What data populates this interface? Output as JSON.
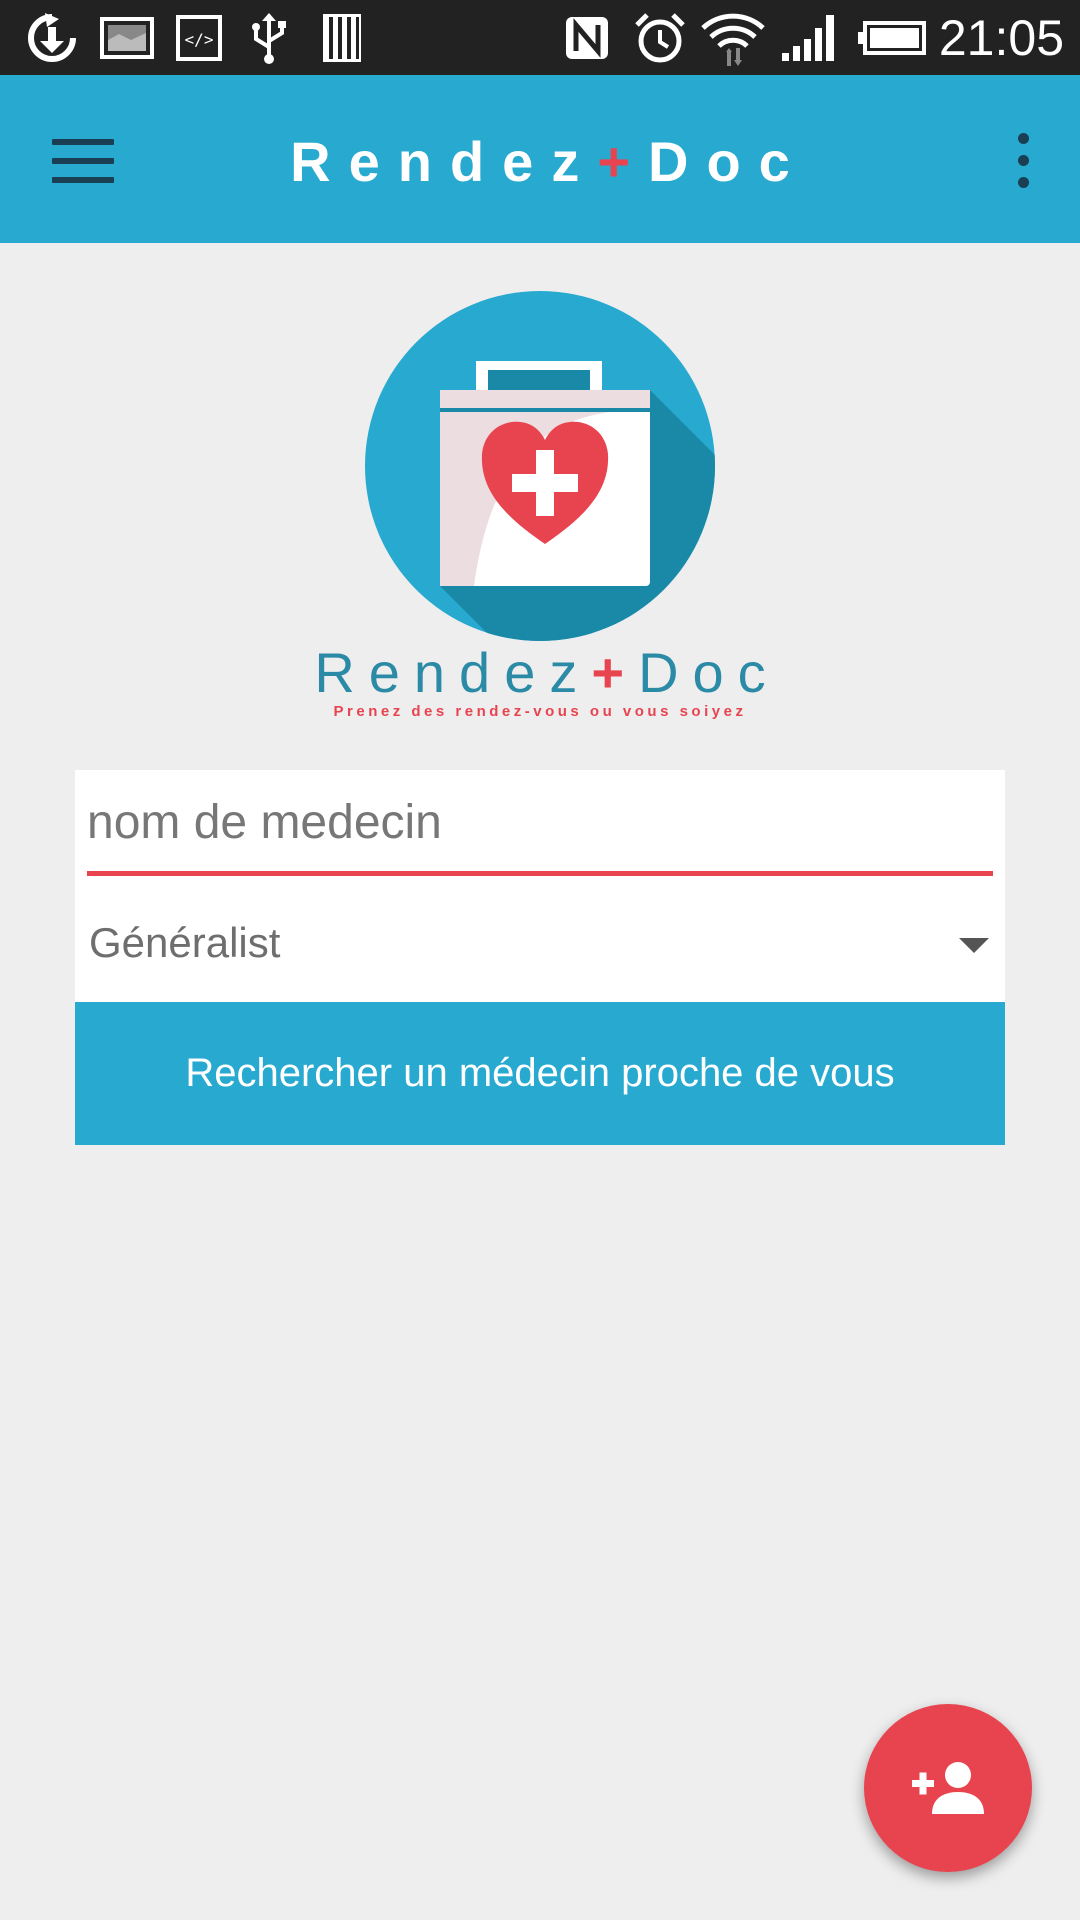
{
  "status_bar": {
    "time": "21:05",
    "icons": [
      "sync-download-icon",
      "image-icon",
      "code-icon",
      "usb-icon",
      "sd-card-icon",
      "nfc-icon",
      "alarm-icon",
      "wifi-icon",
      "signal-icon",
      "battery-icon"
    ]
  },
  "app_bar": {
    "title_left": "Rendez",
    "title_plus": "+",
    "title_right": "Doc",
    "menu_icon": "hamburger-menu-icon",
    "overflow_icon": "more-vert-icon"
  },
  "logo": {
    "name_left": "Rendez",
    "name_plus": "+",
    "name_right": "Doc",
    "tagline": "Prenez des rendez-vous ou vous soiyez",
    "icon": "medical-kit-heart-icon"
  },
  "search_form": {
    "doctor_name_placeholder": "nom de medecin",
    "doctor_name_value": "",
    "specialty_selected": "Généralist",
    "search_button_label": "Rechercher un médecin proche de vous"
  },
  "fab": {
    "icon": "add-person-icon"
  },
  "colors": {
    "primary": "#27a9d0",
    "accent": "#e84450",
    "background": "#eeeeee",
    "status_bar": "#222222"
  }
}
